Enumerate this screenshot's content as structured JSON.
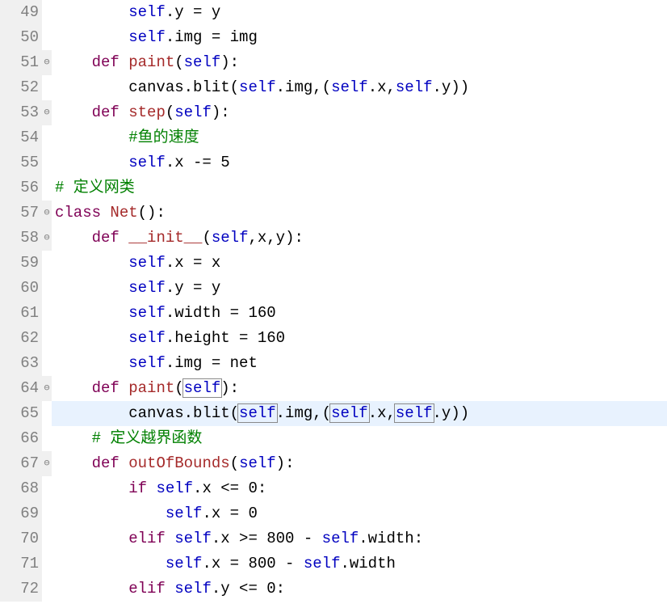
{
  "lines": [
    {
      "num": "49",
      "fold": "",
      "hl": false,
      "tokens": [
        {
          "t": "        ",
          "c": ""
        },
        {
          "t": "self",
          "c": "blue"
        },
        {
          "t": ".y = y",
          "c": ""
        }
      ]
    },
    {
      "num": "50",
      "fold": "",
      "hl": false,
      "tokens": [
        {
          "t": "        ",
          "c": ""
        },
        {
          "t": "self",
          "c": "blue"
        },
        {
          "t": ".img = img",
          "c": ""
        }
      ]
    },
    {
      "num": "51",
      "fold": "⊖",
      "hl": false,
      "tokens": [
        {
          "t": "    ",
          "c": ""
        },
        {
          "t": "def",
          "c": "kw"
        },
        {
          "t": " ",
          "c": ""
        },
        {
          "t": "paint",
          "c": "func"
        },
        {
          "t": "(",
          "c": ""
        },
        {
          "t": "self",
          "c": "blue"
        },
        {
          "t": "):",
          "c": ""
        }
      ]
    },
    {
      "num": "52",
      "fold": "",
      "hl": false,
      "tokens": [
        {
          "t": "        canvas.blit(",
          "c": ""
        },
        {
          "t": "self",
          "c": "blue"
        },
        {
          "t": ".img,(",
          "c": ""
        },
        {
          "t": "self",
          "c": "blue"
        },
        {
          "t": ".x,",
          "c": ""
        },
        {
          "t": "self",
          "c": "blue"
        },
        {
          "t": ".y))",
          "c": ""
        }
      ]
    },
    {
      "num": "53",
      "fold": "⊖",
      "hl": false,
      "tokens": [
        {
          "t": "    ",
          "c": ""
        },
        {
          "t": "def",
          "c": "kw"
        },
        {
          "t": " ",
          "c": ""
        },
        {
          "t": "step",
          "c": "func"
        },
        {
          "t": "(",
          "c": ""
        },
        {
          "t": "self",
          "c": "blue"
        },
        {
          "t": "):",
          "c": ""
        }
      ]
    },
    {
      "num": "54",
      "fold": "",
      "hl": false,
      "tokens": [
        {
          "t": "        ",
          "c": ""
        },
        {
          "t": "#鱼的速度",
          "c": "comment"
        }
      ]
    },
    {
      "num": "55",
      "fold": "",
      "hl": false,
      "tokens": [
        {
          "t": "        ",
          "c": ""
        },
        {
          "t": "self",
          "c": "blue"
        },
        {
          "t": ".x -= 5",
          "c": ""
        }
      ]
    },
    {
      "num": "56",
      "fold": "",
      "hl": false,
      "tokens": [
        {
          "t": "# 定义网类",
          "c": "comment"
        }
      ]
    },
    {
      "num": "57",
      "fold": "⊖",
      "hl": false,
      "tokens": [
        {
          "t": "class",
          "c": "kw"
        },
        {
          "t": " ",
          "c": ""
        },
        {
          "t": "Net",
          "c": "classname"
        },
        {
          "t": "():",
          "c": ""
        }
      ]
    },
    {
      "num": "58",
      "fold": "⊖",
      "hl": false,
      "tokens": [
        {
          "t": "    ",
          "c": ""
        },
        {
          "t": "def",
          "c": "kw"
        },
        {
          "t": " ",
          "c": ""
        },
        {
          "t": "__init__",
          "c": "func"
        },
        {
          "t": "(",
          "c": ""
        },
        {
          "t": "self",
          "c": "blue"
        },
        {
          "t": ",x,y):",
          "c": ""
        }
      ]
    },
    {
      "num": "59",
      "fold": "",
      "hl": false,
      "tokens": [
        {
          "t": "        ",
          "c": ""
        },
        {
          "t": "self",
          "c": "blue"
        },
        {
          "t": ".x = x",
          "c": ""
        }
      ]
    },
    {
      "num": "60",
      "fold": "",
      "hl": false,
      "tokens": [
        {
          "t": "        ",
          "c": ""
        },
        {
          "t": "self",
          "c": "blue"
        },
        {
          "t": ".y = y",
          "c": ""
        }
      ]
    },
    {
      "num": "61",
      "fold": "",
      "hl": false,
      "tokens": [
        {
          "t": "        ",
          "c": ""
        },
        {
          "t": "self",
          "c": "blue"
        },
        {
          "t": ".width = 160",
          "c": ""
        }
      ]
    },
    {
      "num": "62",
      "fold": "",
      "hl": false,
      "tokens": [
        {
          "t": "        ",
          "c": ""
        },
        {
          "t": "self",
          "c": "blue"
        },
        {
          "t": ".height = 160",
          "c": ""
        }
      ]
    },
    {
      "num": "63",
      "fold": "",
      "hl": false,
      "tokens": [
        {
          "t": "        ",
          "c": ""
        },
        {
          "t": "self",
          "c": "blue"
        },
        {
          "t": ".img = net",
          "c": ""
        }
      ]
    },
    {
      "num": "64",
      "fold": "⊖",
      "hl": false,
      "tokens": [
        {
          "t": "    ",
          "c": ""
        },
        {
          "t": "def",
          "c": "kw"
        },
        {
          "t": " ",
          "c": ""
        },
        {
          "t": "paint",
          "c": "func"
        },
        {
          "t": "(",
          "c": ""
        },
        {
          "t": "self",
          "c": "blue",
          "box": true
        },
        {
          "t": "):",
          "c": ""
        }
      ]
    },
    {
      "num": "65",
      "fold": "",
      "hl": true,
      "tokens": [
        {
          "t": "        canvas.blit(",
          "c": ""
        },
        {
          "t": "self",
          "c": "blue",
          "box": true
        },
        {
          "t": ".img,(",
          "c": ""
        },
        {
          "t": "self",
          "c": "blue",
          "box": true
        },
        {
          "t": ".x,",
          "c": ""
        },
        {
          "t": "self",
          "c": "blue",
          "box": true
        },
        {
          "t": ".y))",
          "c": ""
        }
      ]
    },
    {
      "num": "66",
      "fold": "",
      "hl": false,
      "tokens": [
        {
          "t": "    ",
          "c": ""
        },
        {
          "t": "# 定义越界函数",
          "c": "comment"
        }
      ]
    },
    {
      "num": "67",
      "fold": "⊖",
      "hl": false,
      "tokens": [
        {
          "t": "    ",
          "c": ""
        },
        {
          "t": "def",
          "c": "kw"
        },
        {
          "t": " ",
          "c": ""
        },
        {
          "t": "outOfBounds",
          "c": "func"
        },
        {
          "t": "(",
          "c": ""
        },
        {
          "t": "self",
          "c": "blue"
        },
        {
          "t": "):",
          "c": ""
        }
      ]
    },
    {
      "num": "68",
      "fold": "",
      "hl": false,
      "tokens": [
        {
          "t": "        ",
          "c": ""
        },
        {
          "t": "if",
          "c": "kw"
        },
        {
          "t": " ",
          "c": ""
        },
        {
          "t": "self",
          "c": "blue"
        },
        {
          "t": ".x <= 0:",
          "c": ""
        }
      ]
    },
    {
      "num": "69",
      "fold": "",
      "hl": false,
      "tokens": [
        {
          "t": "            ",
          "c": ""
        },
        {
          "t": "self",
          "c": "blue"
        },
        {
          "t": ".x = 0",
          "c": ""
        }
      ]
    },
    {
      "num": "70",
      "fold": "",
      "hl": false,
      "tokens": [
        {
          "t": "        ",
          "c": ""
        },
        {
          "t": "elif",
          "c": "kw"
        },
        {
          "t": " ",
          "c": ""
        },
        {
          "t": "self",
          "c": "blue"
        },
        {
          "t": ".x >= 800 - ",
          "c": ""
        },
        {
          "t": "self",
          "c": "blue"
        },
        {
          "t": ".width:",
          "c": ""
        }
      ]
    },
    {
      "num": "71",
      "fold": "",
      "hl": false,
      "tokens": [
        {
          "t": "            ",
          "c": ""
        },
        {
          "t": "self",
          "c": "blue"
        },
        {
          "t": ".x = 800 - ",
          "c": ""
        },
        {
          "t": "self",
          "c": "blue"
        },
        {
          "t": ".width",
          "c": ""
        }
      ]
    },
    {
      "num": "72",
      "fold": "",
      "hl": false,
      "tokens": [
        {
          "t": "        ",
          "c": ""
        },
        {
          "t": "elif",
          "c": "kw"
        },
        {
          "t": " ",
          "c": ""
        },
        {
          "t": "self",
          "c": "blue"
        },
        {
          "t": ".y <= 0:",
          "c": ""
        }
      ]
    }
  ]
}
